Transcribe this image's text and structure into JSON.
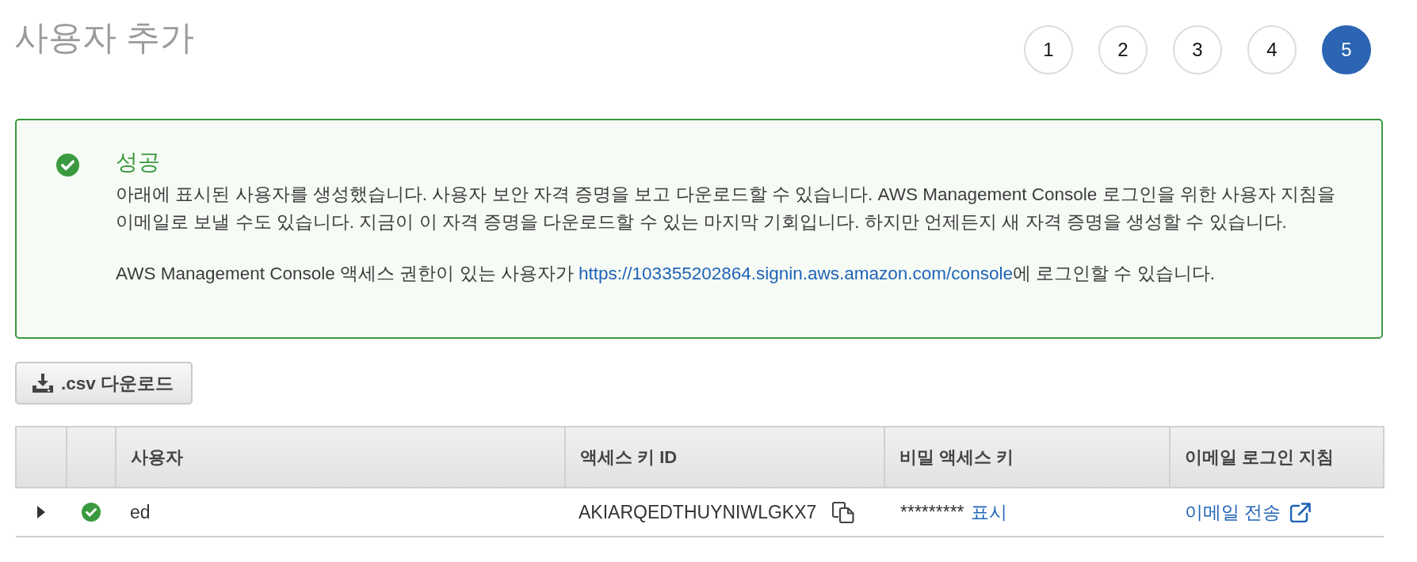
{
  "page": {
    "title": "사용자 추가"
  },
  "steps": [
    {
      "label": "1",
      "selected": false
    },
    {
      "label": "2",
      "selected": false
    },
    {
      "label": "3",
      "selected": false
    },
    {
      "label": "4",
      "selected": false
    },
    {
      "label": "5",
      "selected": true
    }
  ],
  "alert": {
    "kind": "success",
    "title": "성공",
    "lines": [
      "아래에 표시된 사용자를 생성했습니다. 사용자 보안 자격 증명을 보고 다운로드할 수 있습니다. AWS Management Console 로그인을 위한 사용자 지침을",
      "이메일로 보낼 수도 있습니다. 지금이 이 자격 증명을 다운로드할 수 있는 마지막 기회입니다. 하지만 언제든지 새 자격 증명을 생성할 수 있습니다."
    ],
    "note": {
      "before": "AWS Management Console 액세스 권한이 있는 사용자가 ",
      "link": "https://103355202864.signin.aws.amazon.com/console",
      "after": "에 로그인할 수 있습니다."
    }
  },
  "download_button": {
    "label": ".csv 다운로드"
  },
  "table": {
    "columns": [
      "사용자",
      "액세스 키 ID",
      "비밀 액세스 키",
      "이메일 로그인 지침"
    ],
    "rows": [
      {
        "expanded": false,
        "kind": "success",
        "user": "ed",
        "access_key_id": "AKIARQEDTHUYNIWLGKX7",
        "secret_key": "*********",
        "secret_action": "표시",
        "email_action": "이메일 전송"
      }
    ]
  }
}
